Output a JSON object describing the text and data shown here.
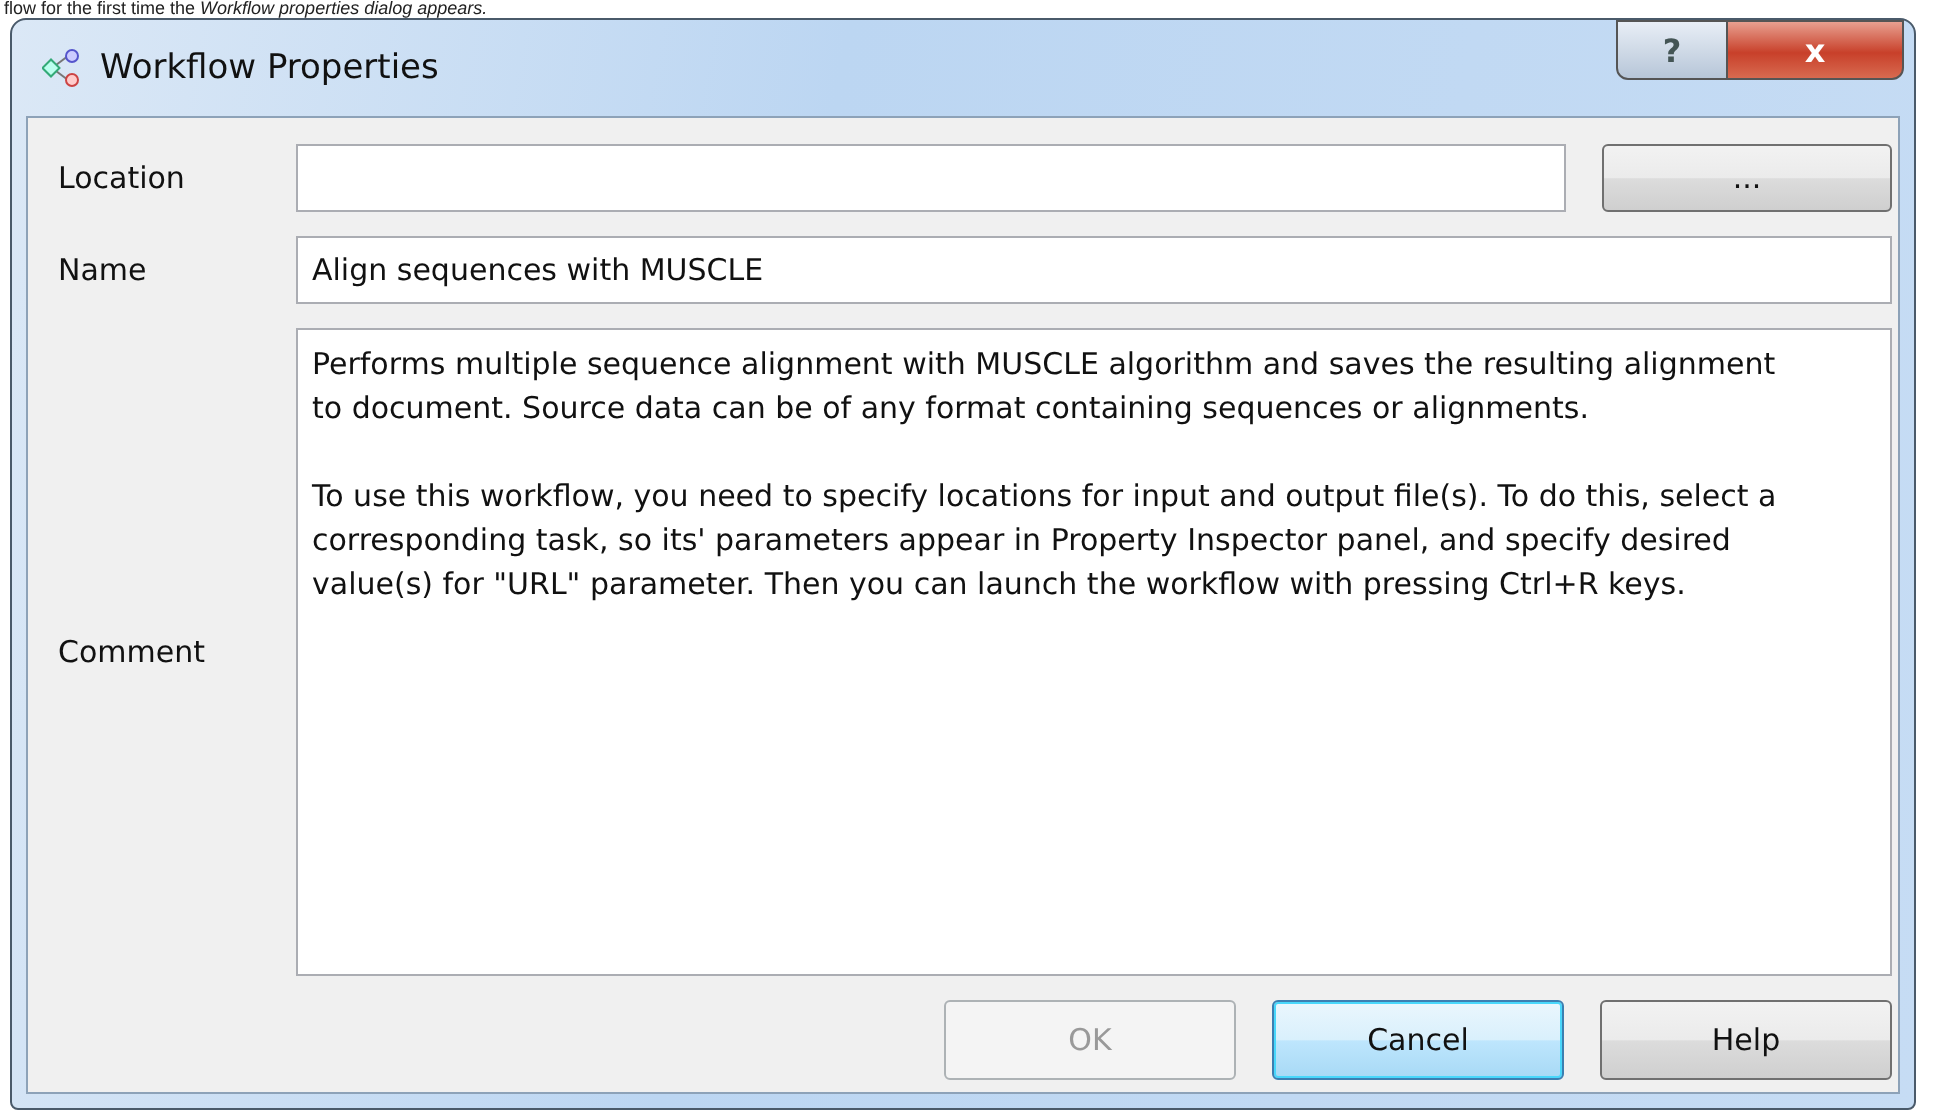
{
  "caption": "flow for the first time the *Workflow properties dialog appears.*",
  "window": {
    "title": "Workflow Properties",
    "controls": [
      {
        "kind": "help",
        "label": "?"
      },
      {
        "kind": "close",
        "label": "x"
      }
    ]
  },
  "fields": [
    {
      "kind": "path",
      "label": "Location",
      "browse": "..."
    },
    {
      "kind": "text",
      "label": "Name",
      "value": "Align sequences with MUSCLE"
    },
    {
      "kind": "multiline",
      "label": "Comment",
      "value": "Performs multiple sequence alignment with MUSCLE algorithm and saves the resulting alignment to document. Source data can be of any format containing sequences or alignments.\n\nTo use this workflow, you need to specify locations for input and output file(s). To do this, select a corresponding task, so its' parameters appear in Property Inspector panel, and specify desired value(s) for \"URL\" parameter. Then you can launch the workflow with pressing Ctrl+R keys."
    }
  ],
  "buttons": [
    {
      "label": "OK",
      "disabled": true,
      "default": false
    },
    {
      "label": "Cancel",
      "disabled": false,
      "default": true
    },
    {
      "label": "Help",
      "disabled": false,
      "default": false
    }
  ]
}
